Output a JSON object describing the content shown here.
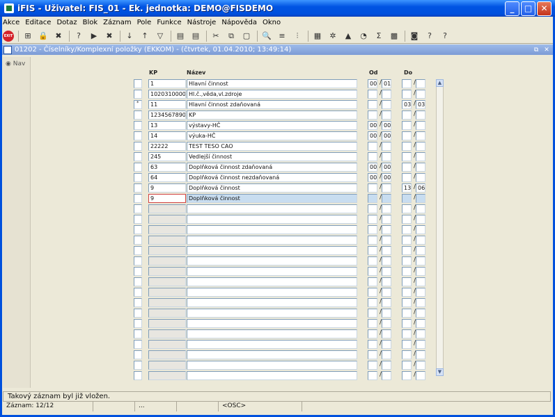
{
  "window": {
    "title": "iFIS - Uživatel: FIS_01 - Ek. jednotka: DEMO@FISDEMO",
    "minimize_glyph": "_",
    "maximize_glyph": "□",
    "close_glyph": "✕"
  },
  "menu": [
    "Akce",
    "Editace",
    "Dotaz",
    "Blok",
    "Záznam",
    "Pole",
    "Funkce",
    "Nástroje",
    "Nápověda",
    "Okno"
  ],
  "toolbar": {
    "exit_label": "EXIT",
    "icons": [
      "insert-record-icon",
      "lock-record-icon",
      "delete-record-icon",
      "enter-query-icon",
      "execute-query-icon",
      "cancel-query-icon",
      "sort-asc-icon",
      "sort-desc-icon",
      "filter-icon",
      "print-icon",
      "print-setup-icon",
      "cut-icon",
      "copy-icon",
      "paste-icon",
      "find-icon",
      "list-icon",
      "tree-icon",
      "calculator-icon",
      "settings-icon",
      "warning-icon",
      "calendar-icon",
      "sum-icon",
      "excel-icon",
      "save-icon",
      "help-icon",
      "context-help-icon"
    ],
    "glyphs": [
      "⊞",
      "🔒",
      "✖",
      "?",
      "▶",
      "✖",
      "↓",
      "↑",
      "▽",
      "▤",
      "▤",
      "✂",
      "⧉",
      "▢",
      "🔍",
      "≡",
      "⫶",
      "▦",
      "✲",
      "▲",
      "◔",
      "Σ",
      "▩",
      "◙",
      "?",
      "?"
    ]
  },
  "child_window": {
    "title": "01202 - Číselníky/Komplexní položky (EKKOM) - (čtvrtek, 01.04.2010; 13:49:14)",
    "restore_glyph": "⧉",
    "close_glyph": "✕"
  },
  "nav": {
    "label": "Nav"
  },
  "columns": {
    "kp": "KP",
    "nazev": "Název",
    "od": "Od",
    "do": "Do"
  },
  "rows": [
    {
      "marker": "",
      "kp": "1",
      "nazev": "Hlavní činnost",
      "od1": "00",
      "od2": "01",
      "do1": "",
      "do2": ""
    },
    {
      "marker": "",
      "kp": "1020310000",
      "nazev": "Hl.č.,věda,vl.zdroje",
      "od1": "",
      "od2": "",
      "do1": "",
      "do2": ""
    },
    {
      "marker": "*",
      "kp": "11",
      "nazev": "Hlavní činnost zdaňovaná",
      "od1": "",
      "od2": "",
      "do1": "03",
      "do2": "03"
    },
    {
      "marker": "",
      "kp": "1234567890",
      "nazev": "KP",
      "od1": "",
      "od2": "",
      "do1": "",
      "do2": ""
    },
    {
      "marker": "",
      "kp": "13",
      "nazev": "výstavy-HČ",
      "od1": "00",
      "od2": "00",
      "do1": "",
      "do2": ""
    },
    {
      "marker": "",
      "kp": "14",
      "nazev": "výuka-HČ",
      "od1": "00",
      "od2": "00",
      "do1": "",
      "do2": ""
    },
    {
      "marker": "",
      "kp": "22222",
      "nazev": "TEST TESO CAO",
      "od1": "",
      "od2": "",
      "do1": "",
      "do2": ""
    },
    {
      "marker": "",
      "kp": "245",
      "nazev": "Vedlejší činnost",
      "od1": "",
      "od2": "",
      "do1": "",
      "do2": ""
    },
    {
      "marker": "",
      "kp": "63",
      "nazev": "Doplňková činnost zdaňovaná",
      "od1": "00",
      "od2": "00",
      "do1": "",
      "do2": ""
    },
    {
      "marker": "",
      "kp": "64",
      "nazev": "Doplňková činnost nezdaňovaná",
      "od1": "00",
      "od2": "00",
      "do1": "",
      "do2": ""
    },
    {
      "marker": "",
      "kp": "9",
      "nazev": "Doplňková činnost",
      "od1": "",
      "od2": "",
      "do1": "13",
      "do2": "06"
    },
    {
      "marker": "",
      "kp": "9",
      "nazev": "Doplňková činnost",
      "od1": "",
      "od2": "",
      "do1": "",
      "do2": ""
    }
  ],
  "grid": {
    "total_rows": 29,
    "selected_row": 12
  },
  "slash": "/",
  "scroll": {
    "up": "▲",
    "down": "▼"
  },
  "status": {
    "message": "Takový záznam byl již vložen.",
    "record": "Záznam: 12/12",
    "pane2": "",
    "pane3": "...",
    "pane4": "",
    "mode": "<OSC>"
  },
  "colors": {
    "title_bar": "#0054E3",
    "selected_row": "#C8DDF0",
    "current_cell_border": "#D04040"
  }
}
